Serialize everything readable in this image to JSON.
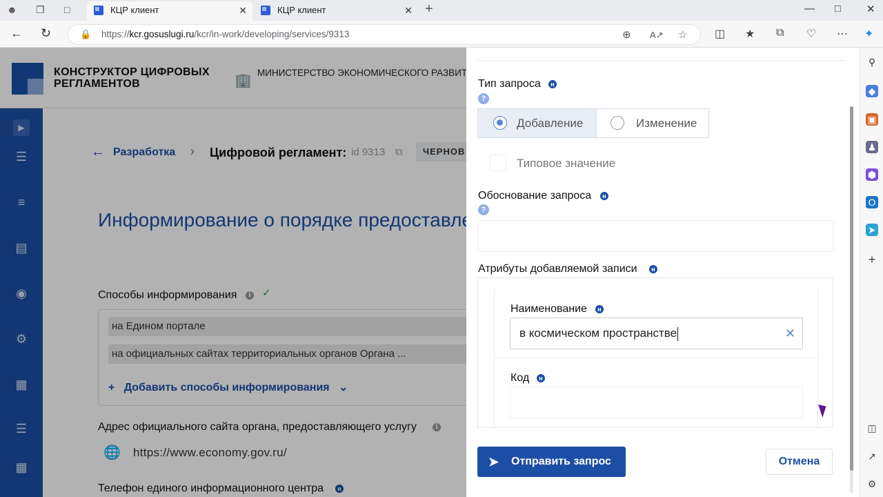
{
  "browser": {
    "tabs": [
      {
        "title": "КЦР клиент",
        "active": true
      },
      {
        "title": "КЦР клиент",
        "active": false
      }
    ],
    "url_prefix": "https://",
    "url_host": "kcr.gosuslugi.ru",
    "url_path": "/kcr/in-work/developing/services/9313"
  },
  "header": {
    "brand": "КОНСТРУКТОР ЦИФРОВЫХ РЕГЛАМЕНТОВ",
    "ministry": "МИНИСТЕРСТВО ЭКОНОМИЧЕСКОГО РАЗВИТ ФЕДЕРАЦИИ"
  },
  "breadcrumb": {
    "back": "Разработка",
    "current": "Цифровой регламент:",
    "id": "id 9313",
    "badge": "ЧЕРНОВ"
  },
  "service": {
    "title": "Информирование о порядке предоставле услуги",
    "methods_label": "Способы информирования",
    "methods": [
      "на Едином портале",
      "на официальных сайтах территориальных органов Органа ..."
    ],
    "add_methods": "Добавить способы информирования",
    "address_label": "Адрес официального сайта органа, предоставляющего услугу",
    "address_value": "https://www.economy.gov.ru/",
    "phone_label": "Телефон единого информационного центра"
  },
  "drawer": {
    "request_type_label": "Тип запроса",
    "options": [
      "Добавление",
      "Изменение"
    ],
    "selected_option": "Добавление",
    "typical_value_label": "Типовое значение",
    "justification_label": "Обоснование запроса",
    "justification_value": "",
    "attributes_label": "Атрибуты добавляемой записи",
    "name_label": "Наименование",
    "name_value": "в космическом пространстве",
    "code_label": "Код",
    "code_value": "",
    "send_label": "Отправить запрос",
    "cancel_label": "Отмена"
  },
  "colors": {
    "brand_blue": "#1d4ea5",
    "accent_radio": "#5a86d6"
  }
}
